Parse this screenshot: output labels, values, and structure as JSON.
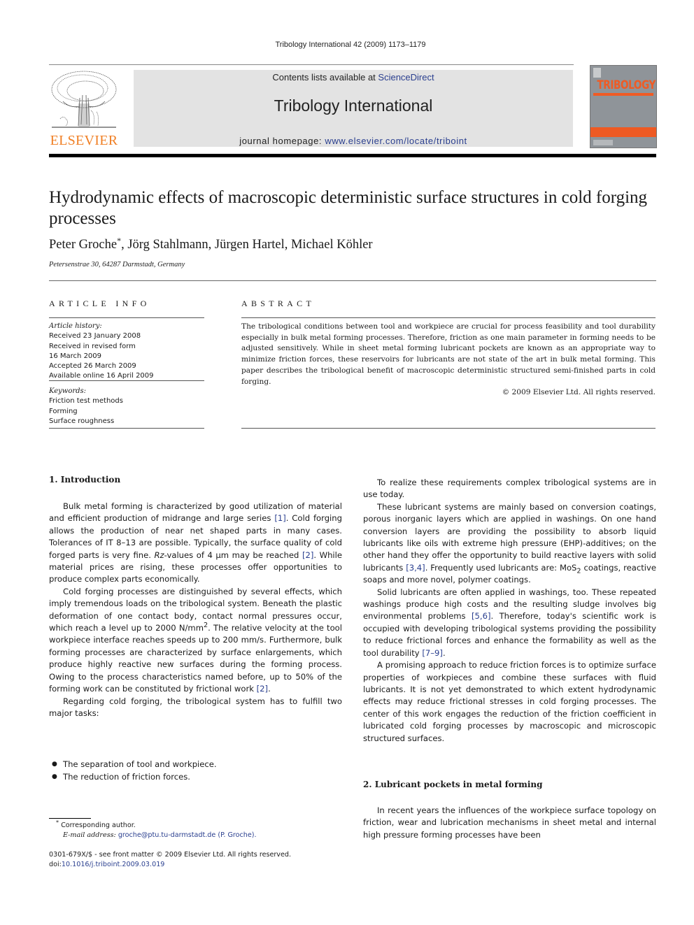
{
  "running_head": "Tribology International 42 (2009) 1173–1179",
  "masthead": {
    "publisher_logo_text": "ELSEVIER",
    "contents_prefix": "Contents lists available at ",
    "contents_link": "ScienceDirect",
    "journal_name": "Tribology International",
    "homepage_prefix": "journal homepage: ",
    "homepage_link": "www.elsevier.com/locate/triboint",
    "cover_title": "TRIBOLOGY",
    "colors": {
      "elsevier_orange": "#f07f24",
      "banner_gray": "#e3e3e3",
      "cover_gray": "#8f9499",
      "cover_orange": "#ee5a23",
      "link_blue": "#2a3f8f"
    }
  },
  "article": {
    "title": "Hydrodynamic effects of macroscopic deterministic surface structures in cold forging processes",
    "authors": [
      {
        "name": "Peter Groche",
        "mark": "*"
      },
      {
        "name": "Jörg Stahlmann",
        "mark": ""
      },
      {
        "name": "Jürgen Hartel",
        "mark": ""
      },
      {
        "name": "Michael Köhler",
        "mark": ""
      }
    ],
    "affiliation": "Petersenstrae 30, 64287 Darmstadt, Germany"
  },
  "article_info": {
    "heading": "ARTICLE INFO",
    "history_label": "Article history:",
    "history": [
      "Received 23 January 2008",
      "Received in revised form",
      "16 March 2009",
      "Accepted 26 March 2009",
      "Available online 16 April 2009"
    ],
    "keywords_label": "Keywords:",
    "keywords": [
      "Friction test methods",
      "Forming",
      "Surface roughness"
    ]
  },
  "abstract": {
    "heading": "ABSTRACT",
    "text": "The tribological conditions between tool and workpiece are crucial for process feasibility and tool durability especially in bulk metal forming processes. Therefore, friction as one main parameter in forming needs to be adjusted sensitively. While in sheet metal forming lubricant pockets are known as an appropriate way to minimize friction forces, these reservoirs for lubricants are not state of the art in bulk metal forming. This paper describes the tribological benefit of macroscopic deterministic structured semi-finished parts in cold forging.",
    "copyright": "© 2009 Elsevier Ltd. All rights reserved."
  },
  "sections": {
    "intro": {
      "heading": "1.  Introduction",
      "p1": {
        "a": "Bulk metal forming is characterized by good utilization of material and efficient production of midrange and large series ",
        "ref1": "[1]",
        "b": ". Cold forging allows the production of near net shaped parts in many cases. Tolerances of IT 8–13 are possible. Typically, the surface quality of cold forged parts is very fine. ",
        "rz": "Rz",
        "c": "-values of 4 µm may be reached ",
        "ref2": "[2]",
        "d": ". While material prices are rising, these processes offer opportunities to produce complex parts economically."
      },
      "p2": {
        "a": "Cold forging processes are distinguished by several effects, which imply tremendous loads on the tribological system. Beneath the plastic deformation of one contact body, contact normal pressures occur, which reach a level up to 2000 N/mm",
        "sup": "2",
        "b": ". The relative velocity at the tool workpiece interface reaches speeds up to 200 mm/s. Furthermore, bulk forming processes are characterized by surface enlargements, which produce highly reactive new surfaces during the forming process. Owing to the process characteristics named before, up to 50% of the forming work can be constituted by frictional work ",
        "ref": "[2]",
        "c": "."
      },
      "p3": "Regarding cold forging, the tribological system has to fulfill two major tasks:",
      "bullets": [
        "The separation of tool and workpiece.",
        "The reduction of friction forces."
      ],
      "p4": "To realize these requirements complex tribological systems are in use today.",
      "p5": {
        "a": "These lubricant systems are mainly based on conversion coatings, porous inorganic layers which are applied in washings. On one hand conversion layers are providing the possibility to absorb liquid lubricants like oils with extreme high pressure (EHP)-additives; on the other hand they offer the opportunity to build reactive layers with solid lubricants ",
        "ref": "[3,4]",
        "b": ". Frequently used lubricants are: MoS",
        "sub": "2",
        "c": " coatings, reactive soaps and more novel, polymer coatings."
      },
      "p6": {
        "a": "Solid lubricants are often applied in washings, too. These repeated washings produce high costs and the resulting sludge involves big environmental problems ",
        "ref1": "[5,6]",
        "b": ". Therefore, today's scientific work is occupied with developing tribological systems providing the possibility to reduce frictional forces and enhance the formability as well as the tool durability ",
        "ref2": "[7–9]",
        "c": "."
      },
      "p7": "A promising approach to reduce friction forces is to optimize surface properties of workpieces and combine these surfaces with fluid lubricants. It is not yet demonstrated to which extent hydrodynamic effects may reduce frictional stresses in cold forging processes. The center of this work engages the reduction of the friction coefficient in lubricated cold forging processes by macroscopic and microscopic structured surfaces."
    },
    "sec2": {
      "heading": "2.  Lubricant pockets in metal forming",
      "p1": "In recent years the influences of the workpiece surface topology on friction, wear and lubrication mechanisms in sheet metal and internal high pressure forming processes have been"
    }
  },
  "footnote": {
    "mark": "*",
    "corresponding": "Corresponding author.",
    "email_label": "E-mail address:",
    "email": "groche@ptu.tu-darmstadt.de",
    "email_suffix": "(P. Groche)."
  },
  "front_matter": {
    "issn_line": "0301-679X/$ - see front matter © 2009 Elsevier Ltd. All rights reserved.",
    "doi_prefix": "doi:",
    "doi": "10.1016/j.triboint.2009.03.019"
  }
}
